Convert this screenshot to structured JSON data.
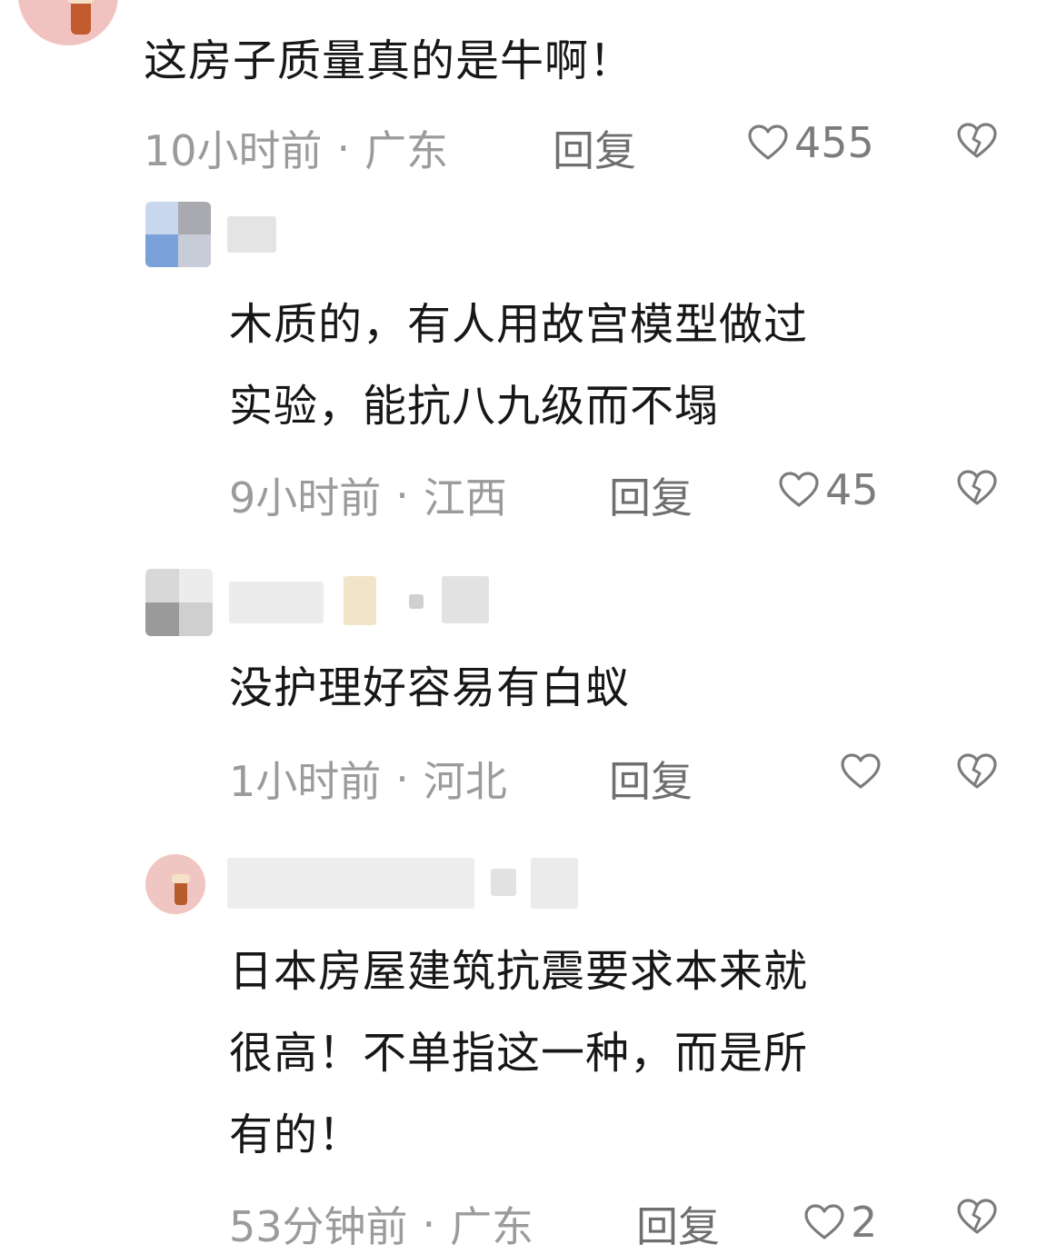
{
  "comments": [
    {
      "text_lines": [
        "这房子质量真的是牛啊！"
      ],
      "time": "10小时前",
      "location": "广东",
      "reply_label": "回复",
      "likes": "455"
    },
    {
      "text_lines": [
        "木质的，有人用故宫模型做过",
        "实验，能抗八九级而不塌"
      ],
      "time": "9小时前",
      "location": "江西",
      "reply_label": "回复",
      "likes": "45"
    },
    {
      "text_lines": [
        "没护理好容易有白蚁"
      ],
      "time": "1小时前",
      "location": "河北",
      "reply_label": "回复",
      "likes": ""
    },
    {
      "text_lines": [
        "日本房屋建筑抗震要求本来就",
        "很高！不单指这一种，而是所",
        "有的！"
      ],
      "time": "53分钟前",
      "location": "广东",
      "reply_label": "回复",
      "likes": "2"
    }
  ],
  "meta_separator": "·",
  "icons": {
    "like": "heart-outline-icon",
    "dislike": "broken-heart-icon"
  },
  "colors": {
    "text": "#171717",
    "meta": "#9b9b9b",
    "reply": "#6f6f6f",
    "icon": "#7c7c7c"
  }
}
